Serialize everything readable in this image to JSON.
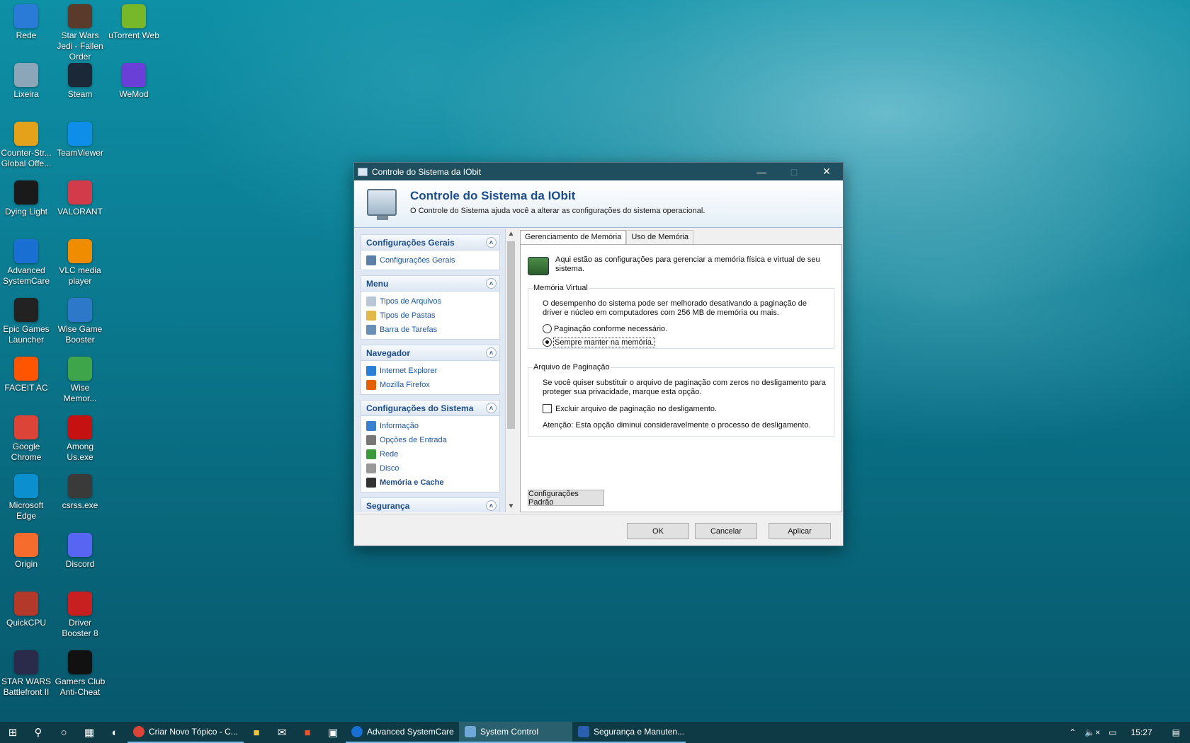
{
  "desktop": {
    "icons": [
      {
        "label": "Rede",
        "color": "#2a7ad8"
      },
      {
        "label": "Star Wars Jedi - Fallen Order",
        "color": "#5a3a2a"
      },
      {
        "label": "uTorrent Web",
        "color": "#76b82a"
      },
      {
        "label": "Lixeira",
        "color": "#8aa6b8"
      },
      {
        "label": "Steam",
        "color": "#1b2838"
      },
      {
        "label": "WeMod",
        "color": "#6a3fd8"
      },
      {
        "label": "Counter-Str... Global Offe...",
        "color": "#e3a21a"
      },
      {
        "label": "TeamViewer",
        "color": "#0e8ee9"
      },
      {
        "label": "Dying Light",
        "color": "#1a1a1a"
      },
      {
        "label": "VALORANT",
        "color": "#d13b4a"
      },
      {
        "label": "Advanced SystemCare",
        "color": "#1a6fd3"
      },
      {
        "label": "VLC media player",
        "color": "#f08c00"
      },
      {
        "label": "Epic Games Launcher",
        "color": "#222222"
      },
      {
        "label": "Wise Game Booster",
        "color": "#2d78c8"
      },
      {
        "label": "FACEIT AC",
        "color": "#ff5500"
      },
      {
        "label": "Wise Memor...",
        "color": "#3fa54a"
      },
      {
        "label": "Google Chrome",
        "color": "#db4437"
      },
      {
        "label": "Among Us.exe",
        "color": "#c51111"
      },
      {
        "label": "Microsoft Edge",
        "color": "#0c8fcf"
      },
      {
        "label": "csrss.exe",
        "color": "#3a3a3a"
      },
      {
        "label": "Origin",
        "color": "#f56c2d"
      },
      {
        "label": "Discord",
        "color": "#5865f2"
      },
      {
        "label": "QuickCPU",
        "color": "#b33a2a"
      },
      {
        "label": "Driver Booster 8",
        "color": "#c82020"
      },
      {
        "label": "STAR WARS Battlefront II",
        "color": "#2a2a4a"
      },
      {
        "label": "Gamers Club Anti-Cheat",
        "color": "#111111"
      }
    ]
  },
  "window": {
    "title": "Controle do Sistema da IObit",
    "banner_title": "Controle do Sistema da IObit",
    "banner_sub": "O Controle do Sistema ajuda você a alterar as configurações do sistema operacional.",
    "left_panel": {
      "groups": [
        {
          "title": "Configurações Gerais",
          "items": [
            {
              "label": "Configurações Gerais",
              "icon": "settings-icon"
            }
          ]
        },
        {
          "title": "Menu",
          "items": [
            {
              "label": "Tipos de Arquivos",
              "icon": "file-icon"
            },
            {
              "label": "Tipos de Pastas",
              "icon": "folder-icon"
            },
            {
              "label": "Barra de Tarefas",
              "icon": "taskbar-icon"
            }
          ]
        },
        {
          "title": "Navegador",
          "items": [
            {
              "label": "Internet Explorer",
              "icon": "ie-icon"
            },
            {
              "label": "Mozilla Firefox",
              "icon": "firefox-icon"
            }
          ]
        },
        {
          "title": "Configurações do Sistema",
          "items": [
            {
              "label": "Informação",
              "icon": "info-icon"
            },
            {
              "label": "Opções de Entrada",
              "icon": "input-icon"
            },
            {
              "label": "Rede",
              "icon": "network-icon"
            },
            {
              "label": "Disco",
              "icon": "disk-icon"
            },
            {
              "label": "Memória e Cache",
              "icon": "memory-icon"
            }
          ]
        },
        {
          "title": "Segurança",
          "items": []
        }
      ]
    },
    "tabs": [
      "Gerenciamento de Memória",
      "Uso de Memória"
    ],
    "content": {
      "intro": "Aqui estão as configurações para gerenciar a memória física e virtual de seu sistema.",
      "virtual_memory": {
        "legend": "Memória Virtual",
        "text": "O desempenho do sistema pode ser melhorado desativando a paginação de driver e núcleo em computadores com 256 MB de memória ou mais.",
        "option1": "Paginação conforme necessário.",
        "option2": "Sempre manter na memória."
      },
      "paging_file": {
        "legend": "Arquivo de Paginação",
        "text": "Se você quiser substituir o arquivo de paginação com zeros no desligamento para proteger sua privacidade, marque esta opção.",
        "checkbox": "Excluir arquivo de paginação no desligamento.",
        "warning": "Atenção: Esta opção diminui consideravelmente o processo de desligamento."
      },
      "defaults_button": "Configurações Padrão"
    },
    "buttons": {
      "ok": "OK",
      "cancel": "Cancelar",
      "apply": "Aplicar"
    }
  },
  "taskbar": {
    "apps": [
      {
        "label": "Criar Novo Tópico - C...",
        "color": "#db4437"
      },
      {
        "label": "Advanced SystemCare",
        "color": "#1a6fd3"
      },
      {
        "label": "System Control",
        "color": "#6fa8d8"
      },
      {
        "label": "Segurança e Manuten...",
        "color": "#2a5fb0"
      }
    ],
    "clock": "15:27"
  }
}
